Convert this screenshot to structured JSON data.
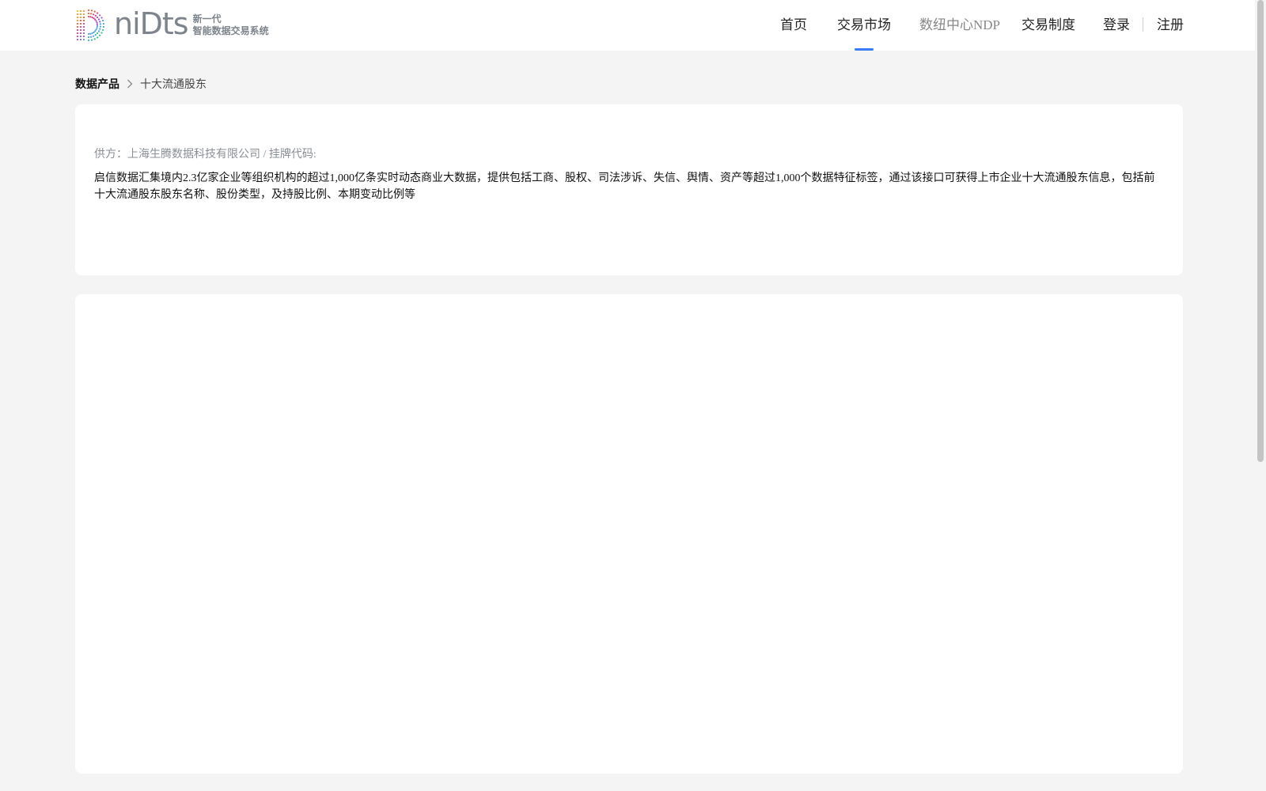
{
  "brand": {
    "wordmark": "niDts",
    "slogan_line1": "新一代",
    "slogan_line2": "智能数据交易系统"
  },
  "nav": {
    "home": "首页",
    "market": "交易市场",
    "ndp": "数纽中心NDP",
    "rules": "交易制度",
    "active": "market"
  },
  "auth": {
    "login": "登录",
    "register": "注册"
  },
  "breadcrumb": {
    "root": "数据产品",
    "current": "十大流通股东"
  },
  "product": {
    "supplier": "供方：上海生腾数据科技有限公司 / 挂牌代码:",
    "description": "启信数据汇集境内2.3亿家企业等组织机构的超过1,000亿条实时动态商业大数据，提供包括工商、股权、司法涉诉、失信、舆情、资产等超过1,000个数据特征标签，通过该接口可获得上市企业十大流通股东信息，包括前十大流通股东股东名称、股份类型，及持股比例、本期变动比例等"
  },
  "colors": {
    "accent": "#3a7cf5",
    "page_bg": "#f4f4f4",
    "muted_text": "#8a8f96"
  },
  "icons": {
    "breadcrumb_separator": "chevron-right-icon",
    "logo_mark": "dotted-d-logo"
  }
}
